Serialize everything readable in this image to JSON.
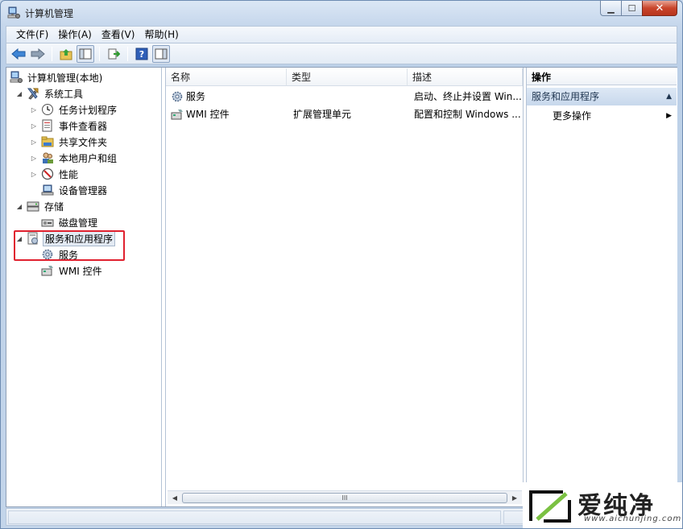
{
  "window": {
    "title": "计算机管理"
  },
  "menu": [
    "文件(F)",
    "操作(A)",
    "查看(V)",
    "帮助(H)"
  ],
  "tree": {
    "root": "计算机管理(本地)",
    "system_tools": "系统工具",
    "task_scheduler": "任务计划程序",
    "event_viewer": "事件查看器",
    "shared_folders": "共享文件夹",
    "local_users": "本地用户和组",
    "performance": "性能",
    "device_manager": "设备管理器",
    "storage": "存储",
    "disk_management": "磁盘管理",
    "services_apps": "服务和应用程序",
    "services": "服务",
    "wmi": "WMI 控件"
  },
  "list": {
    "columns": [
      "名称",
      "类型",
      "描述"
    ],
    "rows": [
      {
        "name": "服务",
        "type": "",
        "desc": "启动、终止并设置 Win..."
      },
      {
        "name": "WMI 控件",
        "type": "扩展管理单元",
        "desc": "配置和控制 Windows ..."
      }
    ],
    "scroll_grip": "III"
  },
  "actions": {
    "header": "操作",
    "section": "服务和应用程序",
    "more": "更多操作"
  },
  "watermark": {
    "text": "爱纯净",
    "url": "www.aichunjing.com"
  },
  "colors": {
    "highlight_box": "#e0212f",
    "accent": "#c8d8ec"
  }
}
